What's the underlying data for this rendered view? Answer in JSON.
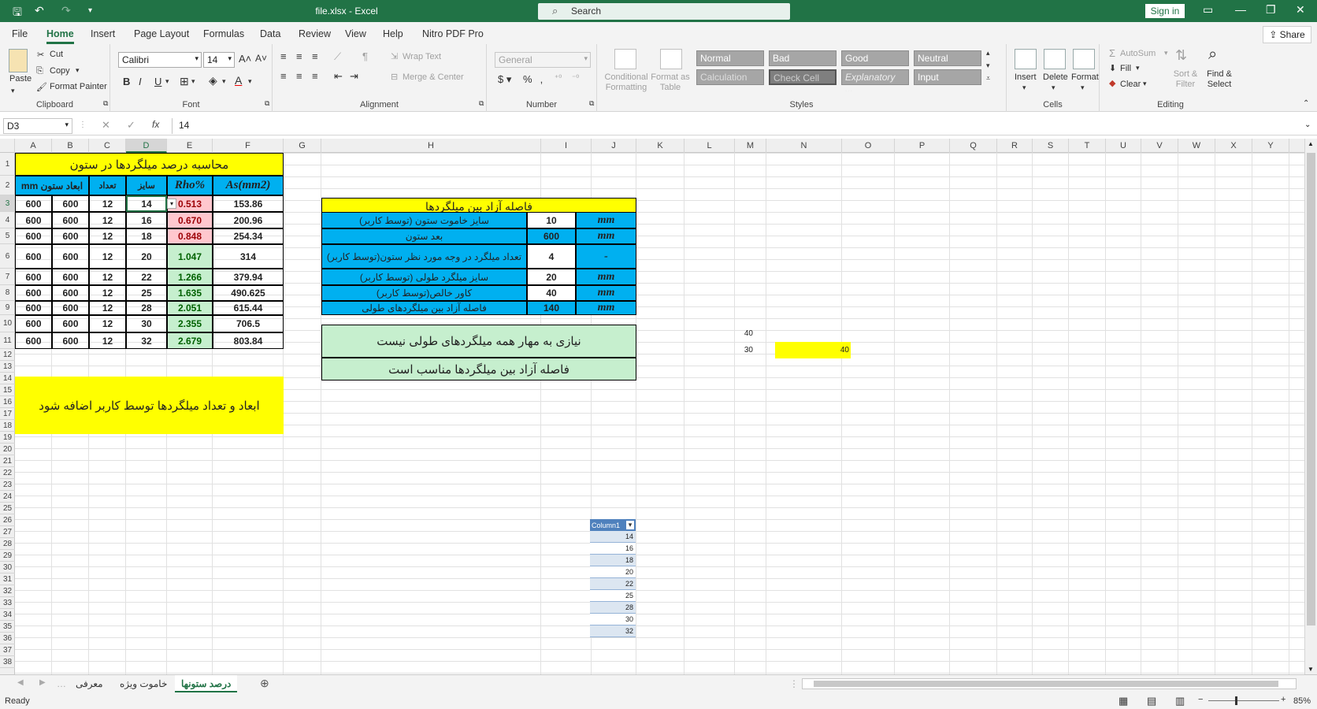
{
  "titlebar": {
    "title": "file.xlsx  -  Excel",
    "search_placeholder": "Search",
    "signin": "Sign in"
  },
  "tabs": [
    "File",
    "Home",
    "Insert",
    "Page Layout",
    "Formulas",
    "Data",
    "Review",
    "View",
    "Help",
    "Nitro PDF Pro"
  ],
  "share": "Share",
  "ribbon": {
    "clipboard": {
      "label": "Clipboard",
      "paste": "Paste",
      "cut": "Cut",
      "copy": "Copy",
      "format_painter": "Format Painter"
    },
    "font": {
      "label": "Font",
      "name": "Calibri",
      "size": "14"
    },
    "alignment": {
      "label": "Alignment",
      "wrap": "Wrap Text",
      "merge": "Merge & Center"
    },
    "number": {
      "label": "Number",
      "format": "General"
    },
    "styles": {
      "label": "Styles",
      "conditional": "Conditional Formatting",
      "format_table": "Format as Table",
      "normal": "Normal",
      "bad": "Bad",
      "good": "Good",
      "neutral": "Neutral",
      "calculation": "Calculation",
      "check": "Check Cell",
      "explanatory": "Explanatory ...",
      "input": "Input"
    },
    "cells": {
      "label": "Cells",
      "insert": "Insert",
      "delete": "Delete",
      "format": "Format"
    },
    "editing": {
      "label": "Editing",
      "autosum": "AutoSum",
      "fill": "Fill",
      "clear": "Clear",
      "sort": "Sort & Filter",
      "find": "Find & Select"
    }
  },
  "formula": {
    "namebox": "D3",
    "value": "14"
  },
  "columns": [
    "A",
    "B",
    "C",
    "D",
    "E",
    "F",
    "G",
    "H",
    "I",
    "J",
    "K",
    "L",
    "M",
    "N",
    "O",
    "P",
    "Q",
    "R",
    "S",
    "T",
    "U",
    "V",
    "W",
    "X",
    "Y"
  ],
  "rows": [
    "1",
    "2",
    "3",
    "4",
    "5",
    "6",
    "7",
    "8",
    "9",
    "10",
    "11",
    "12",
    "13",
    "14",
    "15",
    "16",
    "17",
    "18",
    "19",
    "20",
    "21",
    "22",
    "23",
    "24",
    "25",
    "26",
    "27",
    "28",
    "29",
    "30",
    "31",
    "32",
    "33",
    "34",
    "35",
    "36",
    "37",
    "38"
  ],
  "table1": {
    "title": "محاسبه درصد میلگردها در ستون",
    "headers": [
      "mm ابعاد ستون",
      "تعداد",
      "سایز",
      "Rho%",
      "As(mm2)"
    ],
    "data": [
      [
        "600",
        "600",
        "12",
        "14",
        "0.513",
        "153.86"
      ],
      [
        "600",
        "600",
        "12",
        "16",
        "0.670",
        "200.96"
      ],
      [
        "600",
        "600",
        "12",
        "18",
        "0.848",
        "254.34"
      ],
      [
        "600",
        "600",
        "12",
        "20",
        "1.047",
        "314"
      ],
      [
        "600",
        "600",
        "12",
        "22",
        "1.266",
        "379.94"
      ],
      [
        "600",
        "600",
        "12",
        "25",
        "1.635",
        "490.625"
      ],
      [
        "600",
        "600",
        "12",
        "28",
        "2.051",
        "615.44"
      ],
      [
        "600",
        "600",
        "12",
        "30",
        "2.355",
        "706.5"
      ],
      [
        "600",
        "600",
        "12",
        "32",
        "2.679",
        "803.84"
      ]
    ],
    "note": "ابعاد و تعداد میلگردها توسط کاربر اضافه شود"
  },
  "table2": {
    "title": "فاصله آزاد بین میلگردها",
    "rows": [
      [
        "سایز خاموت ستون (توسط کاربر)",
        "10",
        "mm"
      ],
      [
        "بعد ستون",
        "600",
        "mm"
      ],
      [
        "تعداد میلگرد در وجه مورد نظر ستون(توسط کاربر)",
        "4",
        "-"
      ],
      [
        "سایز میلگرد طولی (توسط کاربر)",
        "20",
        "mm"
      ],
      [
        "کاور خالص(توسط کاربر)",
        "40",
        "mm"
      ],
      [
        "فاصله آزاد بین میلگردهای طولی",
        "140",
        "mm"
      ]
    ],
    "msg1": "نیازی به مهار همه میلگردهای طولی نیست",
    "msg2": "فاصله آزاد بین میلگردها مناسب است"
  },
  "extra": {
    "l10": "40",
    "l11": "30",
    "n11": "40"
  },
  "column1": {
    "header": "Column1",
    "values": [
      "14",
      "16",
      "18",
      "20",
      "22",
      "25",
      "28",
      "30",
      "32"
    ]
  },
  "sheets": [
    "معرفی",
    "خاموت ویژه",
    "درصد ستونها"
  ],
  "status": {
    "ready": "Ready",
    "zoom": "85%"
  },
  "colors": {
    "excel_green": "#217346",
    "yellow": "#ffff00",
    "blue": "#00b0f0",
    "bad_fill": "#ffc7ce",
    "good_fill": "#c6efce"
  }
}
